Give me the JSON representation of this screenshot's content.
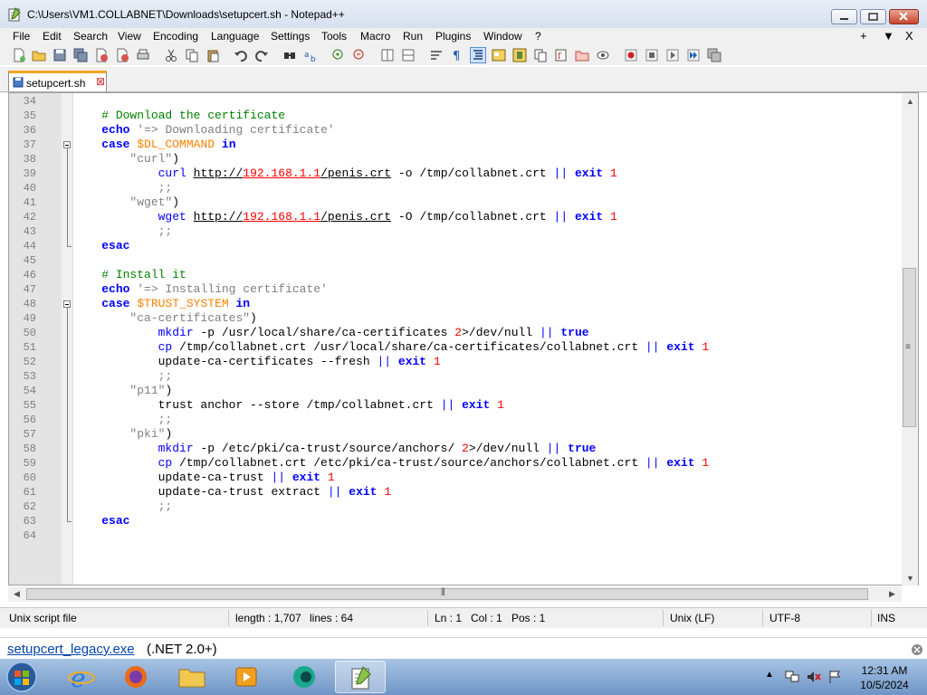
{
  "window": {
    "title": "C:\\Users\\VM1.COLLABNET\\Downloads\\setupcert.sh - Notepad++"
  },
  "menu": {
    "items": [
      "File",
      "Edit",
      "Search",
      "View",
      "Encoding",
      "Language",
      "Settings",
      "Tools",
      "Macro",
      "Run",
      "Plugins",
      "Window",
      "?"
    ],
    "right": [
      "+",
      "▼",
      "X"
    ]
  },
  "tab": {
    "label": "setupcert.sh"
  },
  "editor": {
    "lines": [
      {
        "n": "34",
        "fold": "none",
        "code": []
      },
      {
        "n": "35",
        "fold": "none",
        "code": [
          {
            "t": "    "
          },
          {
            "t": "# Download the certificate",
            "c": "c"
          }
        ]
      },
      {
        "n": "36",
        "fold": "none",
        "code": [
          {
            "t": "    "
          },
          {
            "t": "echo",
            "c": "k"
          },
          {
            "t": " "
          },
          {
            "t": "'=> Downloading certificate'",
            "c": "s"
          }
        ]
      },
      {
        "n": "37",
        "fold": "open",
        "code": [
          {
            "t": "    "
          },
          {
            "t": "case",
            "c": "k"
          },
          {
            "t": " "
          },
          {
            "t": "$DL_COMMAND",
            "c": "v"
          },
          {
            "t": " "
          },
          {
            "t": "in",
            "c": "k"
          }
        ]
      },
      {
        "n": "38",
        "fold": "line",
        "code": [
          {
            "t": "        "
          },
          {
            "t": "\"curl\"",
            "c": "s"
          },
          {
            "t": ")"
          }
        ]
      },
      {
        "n": "39",
        "fold": "line",
        "code": [
          {
            "t": "            "
          },
          {
            "t": "curl",
            "c": "k2"
          },
          {
            "t": " "
          },
          {
            "t": "http://",
            "c": "u"
          },
          {
            "t": "192.168.1.1",
            "c": "n u"
          },
          {
            "t": "/penis.crt",
            "c": "u"
          },
          {
            "t": " -o /tmp/collabnet.crt "
          },
          {
            "t": "||",
            "c": "k2"
          },
          {
            "t": " "
          },
          {
            "t": "exit",
            "c": "k"
          },
          {
            "t": " "
          },
          {
            "t": "1",
            "c": "n"
          }
        ]
      },
      {
        "n": "40",
        "fold": "line",
        "code": [
          {
            "t": "            "
          },
          {
            "t": ";;",
            "c": "s"
          }
        ]
      },
      {
        "n": "41",
        "fold": "line",
        "code": [
          {
            "t": "        "
          },
          {
            "t": "\"wget\"",
            "c": "s"
          },
          {
            "t": ")"
          }
        ]
      },
      {
        "n": "42",
        "fold": "line",
        "code": [
          {
            "t": "            "
          },
          {
            "t": "wget",
            "c": "k2"
          },
          {
            "t": " "
          },
          {
            "t": "http://",
            "c": "u"
          },
          {
            "t": "192.168.1.1",
            "c": "n u"
          },
          {
            "t": "/penis.crt",
            "c": "u"
          },
          {
            "t": " -O /tmp/collabnet.crt "
          },
          {
            "t": "||",
            "c": "k2"
          },
          {
            "t": " "
          },
          {
            "t": "exit",
            "c": "k"
          },
          {
            "t": " "
          },
          {
            "t": "1",
            "c": "n"
          }
        ]
      },
      {
        "n": "43",
        "fold": "line",
        "code": [
          {
            "t": "            "
          },
          {
            "t": ";;",
            "c": "s"
          }
        ]
      },
      {
        "n": "44",
        "fold": "end",
        "code": [
          {
            "t": "    "
          },
          {
            "t": "esac",
            "c": "k"
          }
        ]
      },
      {
        "n": "45",
        "fold": "none",
        "code": []
      },
      {
        "n": "46",
        "fold": "none",
        "code": [
          {
            "t": "    "
          },
          {
            "t": "# Install it",
            "c": "c"
          }
        ]
      },
      {
        "n": "47",
        "fold": "none",
        "code": [
          {
            "t": "    "
          },
          {
            "t": "echo",
            "c": "k"
          },
          {
            "t": " "
          },
          {
            "t": "'=> Installing certificate'",
            "c": "s"
          }
        ]
      },
      {
        "n": "48",
        "fold": "open",
        "code": [
          {
            "t": "    "
          },
          {
            "t": "case",
            "c": "k"
          },
          {
            "t": " "
          },
          {
            "t": "$TRUST_SYSTEM",
            "c": "v"
          },
          {
            "t": " "
          },
          {
            "t": "in",
            "c": "k"
          }
        ]
      },
      {
        "n": "49",
        "fold": "line",
        "code": [
          {
            "t": "        "
          },
          {
            "t": "\"ca-certificates\"",
            "c": "s"
          },
          {
            "t": ")"
          }
        ]
      },
      {
        "n": "50",
        "fold": "line",
        "code": [
          {
            "t": "            "
          },
          {
            "t": "mkdir",
            "c": "k2"
          },
          {
            "t": " -p /usr/local/share/ca-certificates "
          },
          {
            "t": "2",
            "c": "n"
          },
          {
            "t": ">/dev/null "
          },
          {
            "t": "||",
            "c": "k2"
          },
          {
            "t": " "
          },
          {
            "t": "true",
            "c": "k"
          }
        ]
      },
      {
        "n": "51",
        "fold": "line",
        "code": [
          {
            "t": "            "
          },
          {
            "t": "cp",
            "c": "k2"
          },
          {
            "t": " /tmp/collabnet.crt /usr/local/share/ca-certificates/collabnet.crt "
          },
          {
            "t": "||",
            "c": "k2"
          },
          {
            "t": " "
          },
          {
            "t": "exit",
            "c": "k"
          },
          {
            "t": " "
          },
          {
            "t": "1",
            "c": "n"
          }
        ]
      },
      {
        "n": "52",
        "fold": "line",
        "code": [
          {
            "t": "            "
          },
          {
            "t": "update-ca-certificates --fresh "
          },
          {
            "t": "||",
            "c": "k2"
          },
          {
            "t": " "
          },
          {
            "t": "exit",
            "c": "k"
          },
          {
            "t": " "
          },
          {
            "t": "1",
            "c": "n"
          }
        ]
      },
      {
        "n": "53",
        "fold": "line",
        "code": [
          {
            "t": "            "
          },
          {
            "t": ";;",
            "c": "s"
          }
        ]
      },
      {
        "n": "54",
        "fold": "line",
        "code": [
          {
            "t": "        "
          },
          {
            "t": "\"p11\"",
            "c": "s"
          },
          {
            "t": ")"
          }
        ]
      },
      {
        "n": "55",
        "fold": "line",
        "code": [
          {
            "t": "            "
          },
          {
            "t": "trust anchor --store /tmp/collabnet.crt "
          },
          {
            "t": "||",
            "c": "k2"
          },
          {
            "t": " "
          },
          {
            "t": "exit",
            "c": "k"
          },
          {
            "t": " "
          },
          {
            "t": "1",
            "c": "n"
          }
        ]
      },
      {
        "n": "56",
        "fold": "line",
        "code": [
          {
            "t": "            "
          },
          {
            "t": ";;",
            "c": "s"
          }
        ]
      },
      {
        "n": "57",
        "fold": "line",
        "code": [
          {
            "t": "        "
          },
          {
            "t": "\"pki\"",
            "c": "s"
          },
          {
            "t": ")"
          }
        ]
      },
      {
        "n": "58",
        "fold": "line",
        "code": [
          {
            "t": "            "
          },
          {
            "t": "mkdir",
            "c": "k2"
          },
          {
            "t": " -p /etc/pki/ca-trust/source/anchors/ "
          },
          {
            "t": "2",
            "c": "n"
          },
          {
            "t": ">/dev/null "
          },
          {
            "t": "||",
            "c": "k2"
          },
          {
            "t": " "
          },
          {
            "t": "true",
            "c": "k"
          }
        ]
      },
      {
        "n": "59",
        "fold": "line",
        "code": [
          {
            "t": "            "
          },
          {
            "t": "cp",
            "c": "k2"
          },
          {
            "t": " /tmp/collabnet.crt /etc/pki/ca-trust/source/anchors/collabnet.crt "
          },
          {
            "t": "||",
            "c": "k2"
          },
          {
            "t": " "
          },
          {
            "t": "exit",
            "c": "k"
          },
          {
            "t": " "
          },
          {
            "t": "1",
            "c": "n"
          }
        ]
      },
      {
        "n": "60",
        "fold": "line",
        "code": [
          {
            "t": "            "
          },
          {
            "t": "update-ca-trust "
          },
          {
            "t": "||",
            "c": "k2"
          },
          {
            "t": " "
          },
          {
            "t": "exit",
            "c": "k"
          },
          {
            "t": " "
          },
          {
            "t": "1",
            "c": "n"
          }
        ]
      },
      {
        "n": "61",
        "fold": "line",
        "code": [
          {
            "t": "            "
          },
          {
            "t": "update-ca-trust extract "
          },
          {
            "t": "||",
            "c": "k2"
          },
          {
            "t": " "
          },
          {
            "t": "exit",
            "c": "k"
          },
          {
            "t": " "
          },
          {
            "t": "1",
            "c": "n"
          }
        ]
      },
      {
        "n": "62",
        "fold": "line",
        "code": [
          {
            "t": "            "
          },
          {
            "t": ";;",
            "c": "s"
          }
        ]
      },
      {
        "n": "63",
        "fold": "end",
        "code": [
          {
            "t": "    "
          },
          {
            "t": "esac",
            "c": "k"
          }
        ]
      },
      {
        "n": "64",
        "fold": "none",
        "code": []
      }
    ]
  },
  "status": {
    "file_type": "Unix script file",
    "length": "length : 1,707",
    "lines": "lines : 64",
    "ln": "Ln : 1",
    "col": "Col : 1",
    "pos": "Pos : 1",
    "eol": "Unix (LF)",
    "encoding": "UTF-8",
    "mode": "INS"
  },
  "infobar": {
    "link": "setupcert_legacy.exe",
    "rest": "(.NET 2.0+)"
  },
  "taskbar": {
    "time": "12:31 AM",
    "date": "10/5/2024"
  },
  "colors": {
    "keyword": "#0000ff",
    "variable": "#ff8000",
    "string": "#808080",
    "comment": "#008000",
    "number": "#ff0000"
  }
}
